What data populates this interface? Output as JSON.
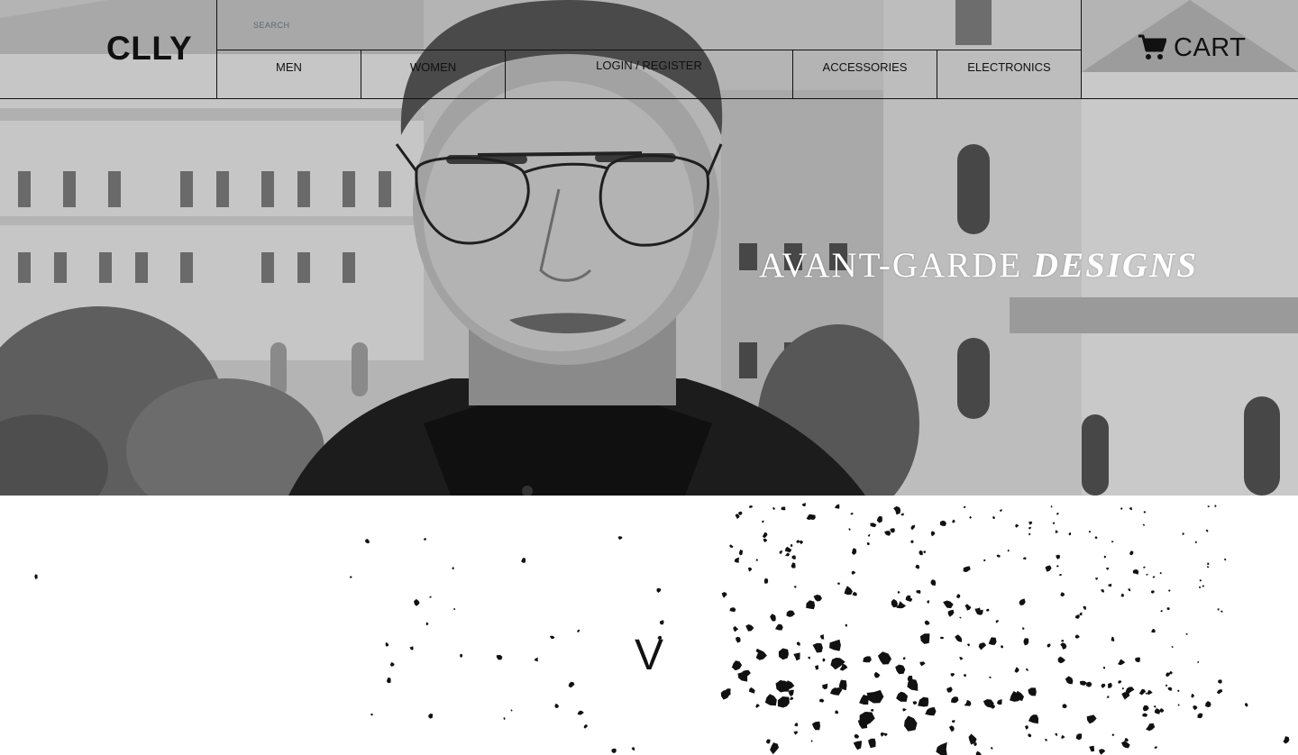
{
  "header": {
    "logo": "CLLY",
    "search": {
      "placeholder": "SEARCH",
      "value": ""
    },
    "nav": [
      {
        "label": "MEN"
      },
      {
        "label": "WOMEN"
      },
      {
        "label": "LOGIN / REGISTER"
      },
      {
        "label": "ACCESSORIES"
      },
      {
        "label": "ELECTRONICS"
      }
    ],
    "cart": {
      "label": "CART",
      "icon": "cart-icon"
    }
  },
  "hero": {
    "title_plain": "AVANT-GARDE ",
    "title_strong": "DESIGNS"
  },
  "splatter": {
    "letter": "V"
  }
}
